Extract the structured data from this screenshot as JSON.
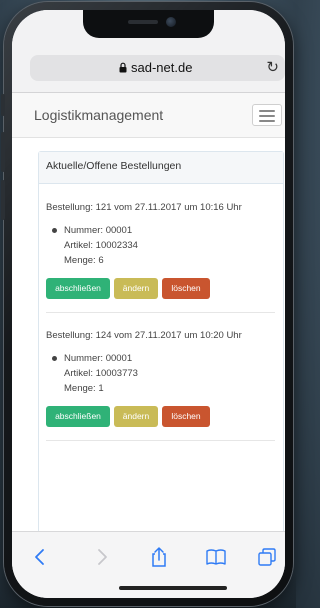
{
  "browser": {
    "url": "sad-net.de"
  },
  "navbar": {
    "brand": "Logistikmanagement"
  },
  "panel": {
    "title": "Aktuelle/Offene Bestellungen"
  },
  "orders": [
    {
      "title": "Bestellung: 121 vom 27.11.2017 um 10:16 Uhr",
      "nummer": "Nummer: 00001",
      "artikel": "Artikel: 10002334",
      "menge": "Menge: 6",
      "buttons": {
        "complete": "abschließen",
        "edit": "ändern",
        "delete": "löschen"
      }
    },
    {
      "title": "Bestellung: 124 vom 27.11.2017 um 10:20 Uhr",
      "nummer": "Nummer: 00001",
      "artikel": "Artikel: 10003773",
      "menge": "Menge: 1",
      "buttons": {
        "complete": "abschließen",
        "edit": "ändern",
        "delete": "löschen"
      }
    }
  ],
  "colors": {
    "success": "#2fb277",
    "warning": "#c9bb57",
    "danger": "#c9552f",
    "toolbar_accent": "#2f7bf5"
  },
  "icons": {
    "lock": "lock-icon",
    "reload": "reload-icon",
    "back": "chevron-left-icon",
    "forward": "chevron-right-icon",
    "share": "share-icon",
    "bookmarks": "book-icon",
    "tabs": "tabs-icon"
  }
}
